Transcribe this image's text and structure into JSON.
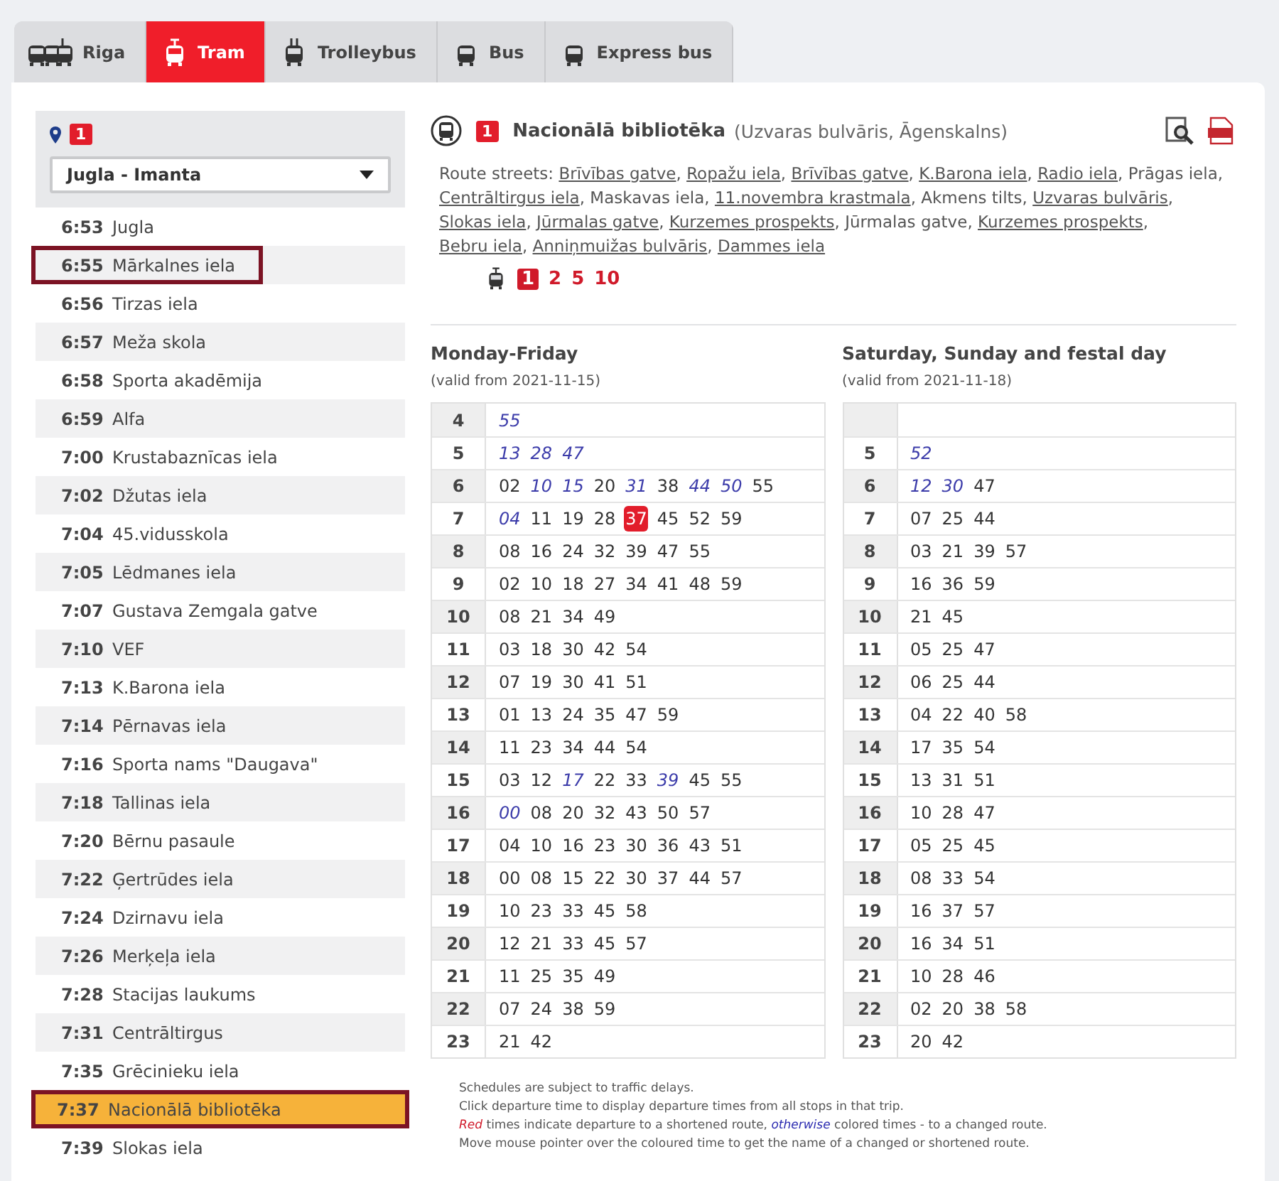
{
  "tabs": [
    {
      "label": "Riga",
      "kind": "all",
      "selected": false
    },
    {
      "label": "Tram",
      "kind": "tram",
      "selected": true
    },
    {
      "label": "Trolleybus",
      "kind": "trolleybus",
      "selected": false
    },
    {
      "label": "Bus",
      "kind": "bus",
      "selected": false
    },
    {
      "label": "Express bus",
      "kind": "bus",
      "selected": false
    }
  ],
  "route": {
    "number": "1",
    "direction": "Jugla - Imanta"
  },
  "stops": [
    {
      "time": "6:53",
      "name": "Jugla",
      "outlined": false,
      "selected": false
    },
    {
      "time": "6:55",
      "name": "Mārkalnes iela",
      "outlined": true,
      "selected": false
    },
    {
      "time": "6:56",
      "name": "Tirzas iela",
      "outlined": false,
      "selected": false
    },
    {
      "time": "6:57",
      "name": "Meža skola",
      "outlined": false,
      "selected": false
    },
    {
      "time": "6:58",
      "name": "Sporta akadēmija",
      "outlined": false,
      "selected": false
    },
    {
      "time": "6:59",
      "name": "Alfa",
      "outlined": false,
      "selected": false
    },
    {
      "time": "7:00",
      "name": "Krustabaznīcas iela",
      "outlined": false,
      "selected": false
    },
    {
      "time": "7:02",
      "name": "Džutas iela",
      "outlined": false,
      "selected": false
    },
    {
      "time": "7:04",
      "name": "45.vidusskola",
      "outlined": false,
      "selected": false
    },
    {
      "time": "7:05",
      "name": "Lēdmanes iela",
      "outlined": false,
      "selected": false
    },
    {
      "time": "7:07",
      "name": "Gustava Zemgala gatve",
      "outlined": false,
      "selected": false
    },
    {
      "time": "7:10",
      "name": "VEF",
      "outlined": false,
      "selected": false
    },
    {
      "time": "7:13",
      "name": "K.Barona iela",
      "outlined": false,
      "selected": false
    },
    {
      "time": "7:14",
      "name": "Pērnavas iela",
      "outlined": false,
      "selected": false
    },
    {
      "time": "7:16",
      "name": "Sporta nams \"Daugava\"",
      "outlined": false,
      "selected": false
    },
    {
      "time": "7:18",
      "name": "Tallinas iela",
      "outlined": false,
      "selected": false
    },
    {
      "time": "7:20",
      "name": "Bērnu pasaule",
      "outlined": false,
      "selected": false
    },
    {
      "time": "7:22",
      "name": "Ģertrūdes iela",
      "outlined": false,
      "selected": false
    },
    {
      "time": "7:24",
      "name": "Dzirnavu iela",
      "outlined": false,
      "selected": false
    },
    {
      "time": "7:26",
      "name": "Merķeļa iela",
      "outlined": false,
      "selected": false
    },
    {
      "time": "7:28",
      "name": "Stacijas laukums",
      "outlined": false,
      "selected": false
    },
    {
      "time": "7:31",
      "name": "Centrāltirgus",
      "outlined": false,
      "selected": false
    },
    {
      "time": "7:35",
      "name": "Grēcinieku iela",
      "outlined": false,
      "selected": false
    },
    {
      "time": "7:37",
      "name": "Nacionālā bibliotēka",
      "outlined": true,
      "selected": true
    },
    {
      "time": "7:39",
      "name": "Slokas iela",
      "outlined": false,
      "selected": false
    }
  ],
  "stop_header": {
    "route_number": "1",
    "stop_name": "Nacionālā bibliotēka",
    "area": "(Uzvaras bulvāris, Āgenskalns)"
  },
  "route_streets": {
    "label": "Route streets:",
    "streets": [
      {
        "name": "Brīvības gatve",
        "link": true,
        "after": ","
      },
      {
        "name": "Ropažu iela",
        "link": true,
        "after": ","
      },
      {
        "name": "Brīvības gatve",
        "link": true,
        "after": ","
      },
      {
        "name": "K.Barona iela",
        "link": true,
        "after": ","
      },
      {
        "name": "Radio iela",
        "link": true,
        "after": ","
      },
      {
        "name": "Prāgas iela",
        "link": false,
        "after": ","
      },
      {
        "name": "Centrāltirgus iela",
        "link": true,
        "after": ","
      },
      {
        "name": "Maskavas iela",
        "link": false,
        "after": ","
      },
      {
        "name": "11.novembra krastmala",
        "link": true,
        "after": ","
      },
      {
        "name": "Akmens tilts",
        "link": false,
        "after": ","
      },
      {
        "name": "Uzvaras bulvāris",
        "link": true,
        "after": ","
      },
      {
        "name": "Slokas iela",
        "link": true,
        "after": ","
      },
      {
        "name": "Jūrmalas gatve",
        "link": true,
        "after": ","
      },
      {
        "name": "Kurzemes prospekts",
        "link": true,
        "after": ","
      },
      {
        "name": "Jūrmalas gatve",
        "link": false,
        "after": ","
      },
      {
        "name": "Kurzemes prospekts",
        "link": true,
        "after": ","
      },
      {
        "name": "Bebru iela",
        "link": true,
        "after": ","
      },
      {
        "name": "Anniņmuižas bulvāris",
        "link": true,
        "after": ","
      },
      {
        "name": "Dammes iela",
        "link": true
      }
    ]
  },
  "stop_routes": [
    {
      "number": "1",
      "selected": true
    },
    {
      "number": "2",
      "selected": false
    },
    {
      "number": "5",
      "selected": false
    },
    {
      "number": "10",
      "selected": false
    }
  ],
  "timetables": [
    {
      "title": "Monday-Friday",
      "valid": "(valid from 2021-11-15)",
      "rows": [
        {
          "hour": "4",
          "minutes": [
            {
              "text": "55",
              "kind": "changed"
            }
          ]
        },
        {
          "hour": "5",
          "minutes": [
            {
              "text": "13",
              "kind": "changed"
            },
            {
              "text": "28",
              "kind": "changed"
            },
            {
              "text": "47",
              "kind": "changed"
            }
          ]
        },
        {
          "hour": "6",
          "minutes": [
            {
              "text": "02",
              "kind": "normal"
            },
            {
              "text": "10",
              "kind": "changed"
            },
            {
              "text": "15",
              "kind": "changed"
            },
            {
              "text": "20",
              "kind": "normal"
            },
            {
              "text": "31",
              "kind": "changed"
            },
            {
              "text": "38",
              "kind": "normal"
            },
            {
              "text": "44",
              "kind": "changed"
            },
            {
              "text": "50",
              "kind": "changed"
            },
            {
              "text": "55",
              "kind": "normal"
            }
          ]
        },
        {
          "hour": "7",
          "minutes": [
            {
              "text": "04",
              "kind": "changed"
            },
            {
              "text": "11",
              "kind": "normal"
            },
            {
              "text": "19",
              "kind": "normal"
            },
            {
              "text": "28",
              "kind": "normal"
            },
            {
              "text": "37",
              "kind": "current"
            },
            {
              "text": "45",
              "kind": "normal"
            },
            {
              "text": "52",
              "kind": "normal"
            },
            {
              "text": "59",
              "kind": "normal"
            }
          ]
        },
        {
          "hour": "8",
          "minutes": [
            {
              "text": "08",
              "kind": "normal"
            },
            {
              "text": "16",
              "kind": "normal"
            },
            {
              "text": "24",
              "kind": "normal"
            },
            {
              "text": "32",
              "kind": "normal"
            },
            {
              "text": "39",
              "kind": "normal"
            },
            {
              "text": "47",
              "kind": "normal"
            },
            {
              "text": "55",
              "kind": "normal"
            }
          ]
        },
        {
          "hour": "9",
          "minutes": [
            {
              "text": "02",
              "kind": "normal"
            },
            {
              "text": "10",
              "kind": "normal"
            },
            {
              "text": "18",
              "kind": "normal"
            },
            {
              "text": "27",
              "kind": "normal"
            },
            {
              "text": "34",
              "kind": "normal"
            },
            {
              "text": "41",
              "kind": "normal"
            },
            {
              "text": "48",
              "kind": "normal"
            },
            {
              "text": "59",
              "kind": "normal"
            }
          ]
        },
        {
          "hour": "10",
          "minutes": [
            {
              "text": "08",
              "kind": "normal"
            },
            {
              "text": "21",
              "kind": "normal"
            },
            {
              "text": "34",
              "kind": "normal"
            },
            {
              "text": "49",
              "kind": "normal"
            }
          ]
        },
        {
          "hour": "11",
          "minutes": [
            {
              "text": "03",
              "kind": "normal"
            },
            {
              "text": "18",
              "kind": "normal"
            },
            {
              "text": "30",
              "kind": "normal"
            },
            {
              "text": "42",
              "kind": "normal"
            },
            {
              "text": "54",
              "kind": "normal"
            }
          ]
        },
        {
          "hour": "12",
          "minutes": [
            {
              "text": "07",
              "kind": "normal"
            },
            {
              "text": "19",
              "kind": "normal"
            },
            {
              "text": "30",
              "kind": "normal"
            },
            {
              "text": "41",
              "kind": "normal"
            },
            {
              "text": "51",
              "kind": "normal"
            }
          ]
        },
        {
          "hour": "13",
          "minutes": [
            {
              "text": "01",
              "kind": "normal"
            },
            {
              "text": "13",
              "kind": "normal"
            },
            {
              "text": "24",
              "kind": "normal"
            },
            {
              "text": "35",
              "kind": "normal"
            },
            {
              "text": "47",
              "kind": "normal"
            },
            {
              "text": "59",
              "kind": "normal"
            }
          ]
        },
        {
          "hour": "14",
          "minutes": [
            {
              "text": "11",
              "kind": "normal"
            },
            {
              "text": "23",
              "kind": "normal"
            },
            {
              "text": "34",
              "kind": "normal"
            },
            {
              "text": "44",
              "kind": "normal"
            },
            {
              "text": "54",
              "kind": "normal"
            }
          ]
        },
        {
          "hour": "15",
          "minutes": [
            {
              "text": "03",
              "kind": "normal"
            },
            {
              "text": "12",
              "kind": "normal"
            },
            {
              "text": "17",
              "kind": "changed"
            },
            {
              "text": "22",
              "kind": "normal"
            },
            {
              "text": "33",
              "kind": "normal"
            },
            {
              "text": "39",
              "kind": "changed"
            },
            {
              "text": "45",
              "kind": "normal"
            },
            {
              "text": "55",
              "kind": "normal"
            }
          ]
        },
        {
          "hour": "16",
          "minutes": [
            {
              "text": "00",
              "kind": "changed"
            },
            {
              "text": "08",
              "kind": "normal"
            },
            {
              "text": "20",
              "kind": "normal"
            },
            {
              "text": "32",
              "kind": "normal"
            },
            {
              "text": "43",
              "kind": "normal"
            },
            {
              "text": "50",
              "kind": "normal"
            },
            {
              "text": "57",
              "kind": "normal"
            }
          ]
        },
        {
          "hour": "17",
          "minutes": [
            {
              "text": "04",
              "kind": "normal"
            },
            {
              "text": "10",
              "kind": "normal"
            },
            {
              "text": "16",
              "kind": "normal"
            },
            {
              "text": "23",
              "kind": "normal"
            },
            {
              "text": "30",
              "kind": "normal"
            },
            {
              "text": "36",
              "kind": "normal"
            },
            {
              "text": "43",
              "kind": "normal"
            },
            {
              "text": "51",
              "kind": "normal"
            }
          ]
        },
        {
          "hour": "18",
          "minutes": [
            {
              "text": "00",
              "kind": "normal"
            },
            {
              "text": "08",
              "kind": "normal"
            },
            {
              "text": "15",
              "kind": "normal"
            },
            {
              "text": "22",
              "kind": "normal"
            },
            {
              "text": "30",
              "kind": "normal"
            },
            {
              "text": "37",
              "kind": "normal"
            },
            {
              "text": "44",
              "kind": "normal"
            },
            {
              "text": "57",
              "kind": "normal"
            }
          ]
        },
        {
          "hour": "19",
          "minutes": [
            {
              "text": "10",
              "kind": "normal"
            },
            {
              "text": "23",
              "kind": "normal"
            },
            {
              "text": "33",
              "kind": "normal"
            },
            {
              "text": "45",
              "kind": "normal"
            },
            {
              "text": "58",
              "kind": "normal"
            }
          ]
        },
        {
          "hour": "20",
          "minutes": [
            {
              "text": "12",
              "kind": "normal"
            },
            {
              "text": "21",
              "kind": "normal"
            },
            {
              "text": "33",
              "kind": "normal"
            },
            {
              "text": "45",
              "kind": "normal"
            },
            {
              "text": "57",
              "kind": "normal"
            }
          ]
        },
        {
          "hour": "21",
          "minutes": [
            {
              "text": "11",
              "kind": "normal"
            },
            {
              "text": "25",
              "kind": "normal"
            },
            {
              "text": "35",
              "kind": "normal"
            },
            {
              "text": "49",
              "kind": "normal"
            }
          ]
        },
        {
          "hour": "22",
          "minutes": [
            {
              "text": "07",
              "kind": "normal"
            },
            {
              "text": "24",
              "kind": "normal"
            },
            {
              "text": "38",
              "kind": "normal"
            },
            {
              "text": "59",
              "kind": "normal"
            }
          ]
        },
        {
          "hour": "23",
          "minutes": [
            {
              "text": "21",
              "kind": "normal"
            },
            {
              "text": "42",
              "kind": "normal"
            }
          ]
        }
      ]
    },
    {
      "title": "Saturday, Sunday and festal day",
      "valid": "(valid from 2021-11-18)",
      "blank_first_row": true,
      "rows": [
        {
          "hour": "5",
          "minutes": [
            {
              "text": "52",
              "kind": "changed"
            }
          ]
        },
        {
          "hour": "6",
          "minutes": [
            {
              "text": "12",
              "kind": "changed"
            },
            {
              "text": "30",
              "kind": "changed"
            },
            {
              "text": "47",
              "kind": "normal"
            }
          ]
        },
        {
          "hour": "7",
          "minutes": [
            {
              "text": "07",
              "kind": "normal"
            },
            {
              "text": "25",
              "kind": "normal"
            },
            {
              "text": "44",
              "kind": "normal"
            }
          ]
        },
        {
          "hour": "8",
          "minutes": [
            {
              "text": "03",
              "kind": "normal"
            },
            {
              "text": "21",
              "kind": "normal"
            },
            {
              "text": "39",
              "kind": "normal"
            },
            {
              "text": "57",
              "kind": "normal"
            }
          ]
        },
        {
          "hour": "9",
          "minutes": [
            {
              "text": "16",
              "kind": "normal"
            },
            {
              "text": "36",
              "kind": "normal"
            },
            {
              "text": "59",
              "kind": "normal"
            }
          ]
        },
        {
          "hour": "10",
          "minutes": [
            {
              "text": "21",
              "kind": "normal"
            },
            {
              "text": "45",
              "kind": "normal"
            }
          ]
        },
        {
          "hour": "11",
          "minutes": [
            {
              "text": "05",
              "kind": "normal"
            },
            {
              "text": "25",
              "kind": "normal"
            },
            {
              "text": "47",
              "kind": "normal"
            }
          ]
        },
        {
          "hour": "12",
          "minutes": [
            {
              "text": "06",
              "kind": "normal"
            },
            {
              "text": "25",
              "kind": "normal"
            },
            {
              "text": "44",
              "kind": "normal"
            }
          ]
        },
        {
          "hour": "13",
          "minutes": [
            {
              "text": "04",
              "kind": "normal"
            },
            {
              "text": "22",
              "kind": "normal"
            },
            {
              "text": "40",
              "kind": "normal"
            },
            {
              "text": "58",
              "kind": "normal"
            }
          ]
        },
        {
          "hour": "14",
          "minutes": [
            {
              "text": "17",
              "kind": "normal"
            },
            {
              "text": "35",
              "kind": "normal"
            },
            {
              "text": "54",
              "kind": "normal"
            }
          ]
        },
        {
          "hour": "15",
          "minutes": [
            {
              "text": "13",
              "kind": "normal"
            },
            {
              "text": "31",
              "kind": "normal"
            },
            {
              "text": "51",
              "kind": "normal"
            }
          ]
        },
        {
          "hour": "16",
          "minutes": [
            {
              "text": "10",
              "kind": "normal"
            },
            {
              "text": "28",
              "kind": "normal"
            },
            {
              "text": "47",
              "kind": "normal"
            }
          ]
        },
        {
          "hour": "17",
          "minutes": [
            {
              "text": "05",
              "kind": "normal"
            },
            {
              "text": "25",
              "kind": "normal"
            },
            {
              "text": "45",
              "kind": "normal"
            }
          ]
        },
        {
          "hour": "18",
          "minutes": [
            {
              "text": "08",
              "kind": "normal"
            },
            {
              "text": "33",
              "kind": "normal"
            },
            {
              "text": "54",
              "kind": "normal"
            }
          ]
        },
        {
          "hour": "19",
          "minutes": [
            {
              "text": "16",
              "kind": "normal"
            },
            {
              "text": "37",
              "kind": "normal"
            },
            {
              "text": "57",
              "kind": "normal"
            }
          ]
        },
        {
          "hour": "20",
          "minutes": [
            {
              "text": "16",
              "kind": "normal"
            },
            {
              "text": "34",
              "kind": "normal"
            },
            {
              "text": "51",
              "kind": "normal"
            }
          ]
        },
        {
          "hour": "21",
          "minutes": [
            {
              "text": "10",
              "kind": "normal"
            },
            {
              "text": "28",
              "kind": "normal"
            },
            {
              "text": "46",
              "kind": "normal"
            }
          ]
        },
        {
          "hour": "22",
          "minutes": [
            {
              "text": "02",
              "kind": "normal"
            },
            {
              "text": "20",
              "kind": "normal"
            },
            {
              "text": "38",
              "kind": "normal"
            },
            {
              "text": "58",
              "kind": "normal"
            }
          ]
        },
        {
          "hour": "23",
          "minutes": [
            {
              "text": "20",
              "kind": "normal"
            },
            {
              "text": "42",
              "kind": "normal"
            }
          ]
        }
      ]
    }
  ],
  "notes": [
    [
      {
        "text": "Schedules are subject to traffic delays.",
        "kind": "plain"
      }
    ],
    [
      {
        "text": "Click departure time to display departure times from all stops in that trip.",
        "kind": "plain"
      }
    ],
    [
      {
        "text": "Red",
        "kind": "red"
      },
      {
        "text": " times indicate departure to a shortened route, ",
        "kind": "plain"
      },
      {
        "text": "otherwise",
        "kind": "blue"
      },
      {
        "text": " colored times - to a changed route.",
        "kind": "plain"
      }
    ],
    [
      {
        "text": "Move mouse pointer over the coloured time to get the name of a changed or shortened route.",
        "kind": "plain"
      }
    ]
  ]
}
